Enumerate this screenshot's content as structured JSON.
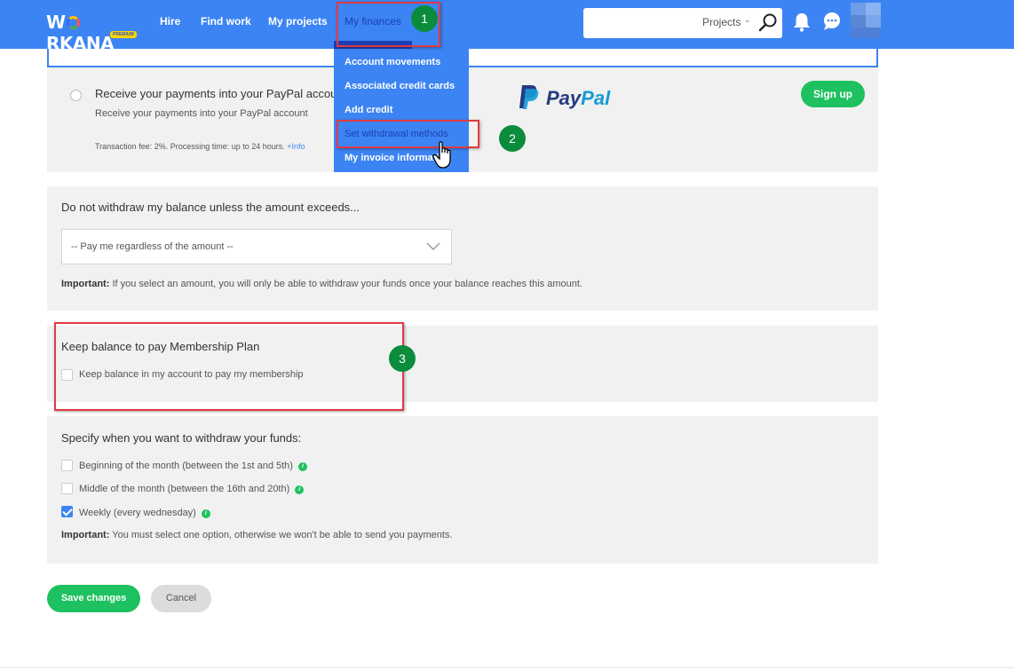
{
  "header": {
    "logo_text": "WORKANA",
    "logo_badge": "PREMIUM",
    "nav": {
      "hire": "Hire",
      "find_work": "Find work",
      "my_projects": "My projects",
      "my_finances": "My finances"
    },
    "search": {
      "placeholder": "",
      "scope": "Projects"
    },
    "colors": {
      "bar": "#3c84f3",
      "active": "#1b3fb3"
    }
  },
  "finances_menu": {
    "items": [
      "Account movements",
      "Associated credit cards",
      "Add credit",
      "Set withdrawal methods",
      "My invoice information"
    ],
    "active_item": "Set withdrawal methods"
  },
  "annotations": {
    "step1": "1",
    "step2": "2",
    "step3": "3"
  },
  "paypal_option": {
    "title": "Receive your payments into your PayPal account",
    "subtitle": "Receive your payments into your PayPal account",
    "fee": "Transaction fee: 2%. Processing time: up to 24 hours.",
    "more_link": "+Info",
    "logo_pay": "Pay",
    "logo_pal": "Pal",
    "signup_button": "Sign up"
  },
  "threshold": {
    "title": "Do not withdraw my balance unless the amount exceeds...",
    "selected": "-- Pay me regardless of the amount --",
    "note_bold": "Important:",
    "note": "If you select an amount, you will only be able to withdraw your funds once your balance reaches this amount."
  },
  "membership": {
    "title": "Keep balance to pay Membership Plan",
    "checkbox_label": "Keep balance in my account to pay my membership",
    "checked": false
  },
  "schedule": {
    "title": "Specify when you want to withdraw your funds:",
    "options": [
      {
        "label": "Beginning of the month (between the 1st and 5th)",
        "checked": false
      },
      {
        "label": "Middle of the month (between the 16th and 20th)",
        "checked": false
      },
      {
        "label": "Weekly (every wednesday)",
        "checked": true
      }
    ],
    "note_bold": "Important:",
    "note": "You must select one option, otherwise we won't be able to send you payments."
  },
  "actions": {
    "save": "Save changes",
    "cancel": "Cancel"
  }
}
